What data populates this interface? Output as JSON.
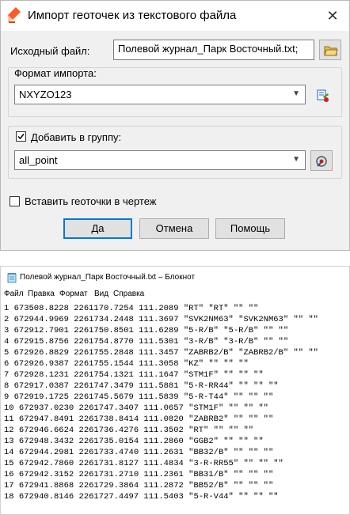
{
  "dialog": {
    "title": "Импорт геоточек из текстового файла",
    "close_glyph": "✕",
    "source_label": "Исходный файл:",
    "source_value": "Полевой журнал_Парк Восточный.txt;",
    "format_group_label": "Формат импорта:",
    "format_value": "NXYZO123",
    "add_group_label": "Добавить в группу:",
    "add_group_checked": true,
    "group_value": "all_point",
    "insert_label": "Вставить геоточки в чертеж",
    "insert_checked": false,
    "buttons": {
      "ok": "Да",
      "cancel": "Отмена",
      "help": "Помощь"
    },
    "accent_color": "#0078d7"
  },
  "notepad": {
    "title": "Полевой журнал_Парк Восточный.txt – Блокнот",
    "menu": [
      "Файл",
      "Правка",
      "Формат",
      "Вид",
      "Справка"
    ],
    "lines": [
      "1 673508.8228 2261170.7254 111.2089 \"RT\" \"RT\" \"\" \"\"",
      "2 672944.9969 2261734.2448 111.3697 \"SVK2NM63\" \"SVK2NM63\" \"\" \"\"",
      "3 672912.7901 2261750.8501 111.6289 \"5-R/B\" \"5-R/B\" \"\" \"\"",
      "4 672915.8756 2261754.8770 111.5301 \"3-R/B\" \"3-R/B\" \"\" \"\"",
      "5 672926.8829 2261755.2848 111.3457 \"ZABRB2/B\" \"ZABRB2/B\" \"\" \"\"",
      "6 672926.9387 2261755.1544 111.3058 \"KZ\" \"\" \"\" \"\"",
      "7 672928.1231 2261754.1321 111.1647 \"STM1F\" \"\" \"\" \"\"",
      "8 672917.0387 2261747.3479 111.5881 \"5-R-RR44\" \"\" \"\" \"\"",
      "9 672919.1725 2261745.5679 111.5839 \"5-R-T44\" \"\" \"\" \"\"",
      "10 672937.0230 2261747.3407 111.0657 \"STM1F\" \"\" \"\" \"\"",
      "11 672947.8491 2261738.8414 111.0820 \"ZABRB2\" \"\" \"\" \"\"",
      "12 672946.6624 2261736.4276 111.3502 \"RT\" \"\" \"\" \"\"",
      "13 672948.3432 2261735.0154 111.2860 \"GGB2\" \"\" \"\" \"\"",
      "14 672944.2981 2261733.4740 111.2631 \"BB32/B\" \"\" \"\" \"\"",
      "15 672942.7860 2261731.8127 111.4834 \"3-R-RR55\" \"\" \"\" \"\"",
      "16 672942.3152 2261731.2710 111.2361 \"BB31/B\" \"\" \"\" \"\"",
      "17 672941.8868 2261729.3864 111.2872 \"BB52/B\" \"\" \"\" \"\"",
      "18 672940.8146 2261727.4497 111.5403 \"5-R-V44\" \"\" \"\" \"\""
    ]
  }
}
